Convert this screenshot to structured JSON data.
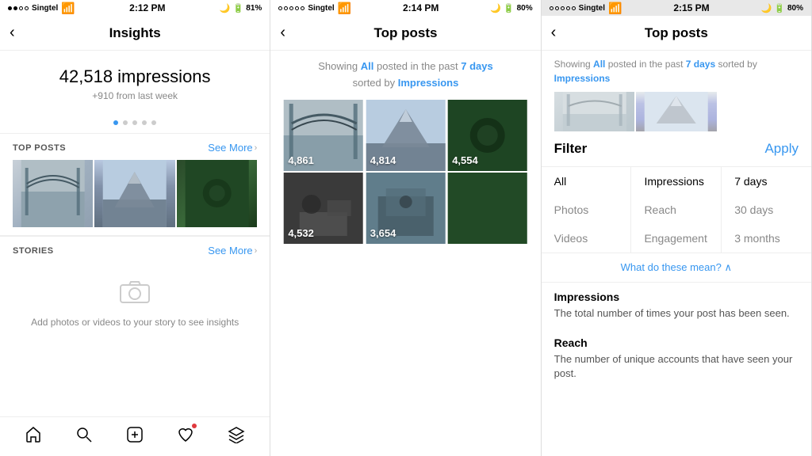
{
  "panel1": {
    "status": {
      "carrier": "Singtel",
      "time": "2:12 PM",
      "battery": "81%"
    },
    "title": "Insights",
    "impressions": {
      "number": "42,518 impressions",
      "delta": "+910 from last week"
    },
    "dots": [
      true,
      false,
      false,
      false,
      false
    ],
    "sections": {
      "top_posts": {
        "label": "TOP POSTS",
        "see_more": "See More"
      },
      "stories": {
        "label": "STORIES",
        "see_more": "See More",
        "empty_text": "Add photos or videos to your story to see insights"
      }
    },
    "nav_items": [
      "home-icon",
      "search-icon",
      "add-icon",
      "heart-icon",
      "layers-icon"
    ]
  },
  "panel2": {
    "status": {
      "carrier": "Singtel",
      "time": "2:14 PM",
      "battery": "80%"
    },
    "title": "Top posts",
    "filter_text_1": "Showing",
    "filter_all": "All",
    "filter_text_2": "posted in the past",
    "filter_days": "7 days",
    "filter_text_3": "sorted by",
    "filter_sorted": "Impressions",
    "posts": [
      {
        "count": "4,861",
        "bg": "bg-bridge"
      },
      {
        "count": "4,814",
        "bg": "bg-mountain"
      },
      {
        "count": "4,554",
        "bg": "bg-forest"
      },
      {
        "count": "4,532",
        "bg": "bg-desk"
      },
      {
        "count": "3,654",
        "bg": "bg-room"
      },
      {
        "count": "",
        "bg": "bg-forest"
      }
    ]
  },
  "panel3": {
    "status": {
      "carrier": "Singtel",
      "time": "2:15 PM",
      "battery": "80%"
    },
    "title": "Top posts",
    "filter_label": "Filter",
    "apply_label": "Apply",
    "filter_subtitle_1": "Showing",
    "filter_all": "All",
    "filter_subtitle_2": "posted in the past",
    "filter_days": "7 days",
    "filter_subtitle_3": "sorted by",
    "filter_sorted": "Impressions",
    "columns": {
      "col1": {
        "options": [
          {
            "label": "All",
            "active": true
          },
          {
            "label": "Photos",
            "active": false
          },
          {
            "label": "Videos",
            "active": false
          }
        ]
      },
      "col2": {
        "options": [
          {
            "label": "Impressions",
            "active": true
          },
          {
            "label": "Reach",
            "active": false
          },
          {
            "label": "Engagement",
            "active": false
          }
        ]
      },
      "col3": {
        "options": [
          {
            "label": "7 days",
            "active": true
          },
          {
            "label": "30 days",
            "active": false
          },
          {
            "label": "3 months",
            "active": false
          }
        ]
      }
    },
    "what_mean": "What do these mean? ∧",
    "info_blocks": [
      {
        "title": "Impressions",
        "desc": "The total number of times your post has been seen."
      },
      {
        "title": "Reach",
        "desc": "The number of unique accounts that have seen your post."
      }
    ]
  }
}
